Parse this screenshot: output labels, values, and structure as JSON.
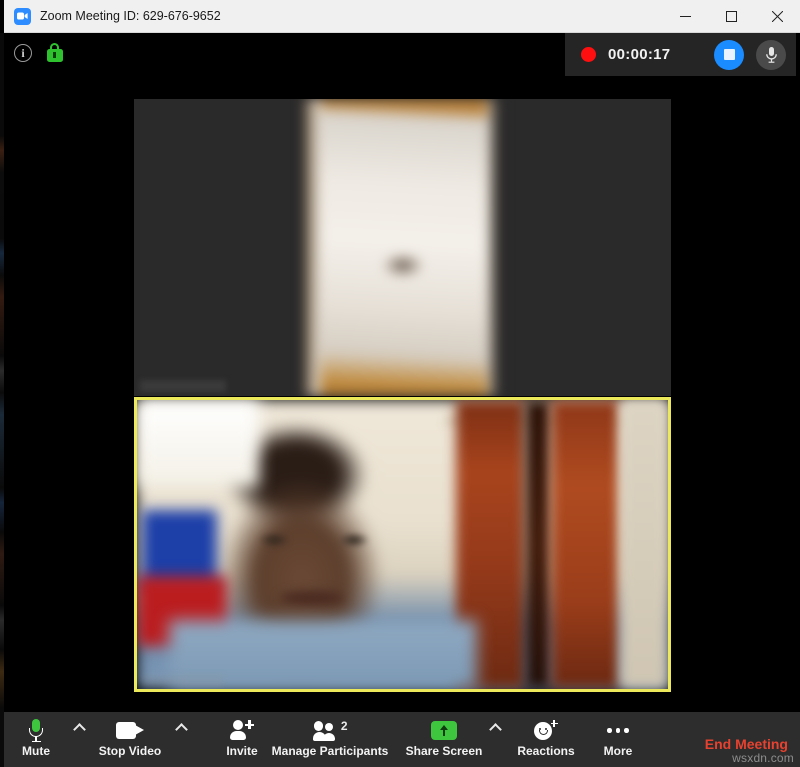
{
  "window": {
    "title": "Zoom Meeting ID: 629-676-9652",
    "app_icon": "zoom-camera-icon",
    "controls": {
      "minimize": "minimize-icon",
      "maximize": "maximize-icon",
      "close": "close-icon"
    }
  },
  "topbar": {
    "info_icon": "info-icon",
    "info_glyph": "i",
    "encryption_icon": "green-lock-icon",
    "recording": {
      "indicator": "record-dot-icon",
      "elapsed": "00:00:17",
      "stop_button": "stop-recording-icon",
      "mic_button": "microphone-icon",
      "accent_color": "#1a8cff",
      "record_color": "#ff0f0f"
    }
  },
  "stage": {
    "tiles": [
      {
        "id": "participant-video-1",
        "name_label": "",
        "active_speaker": false,
        "description": "blurred portrait video of a white door and wall"
      },
      {
        "id": "participant-video-2",
        "name_label": "",
        "active_speaker": true,
        "border_color": "#ece95a",
        "description": "blurred webcam of a person wearing glasses, orange curtains behind"
      }
    ]
  },
  "toolbar": {
    "items": [
      {
        "label": "Mute",
        "icon": "microphone-icon",
        "caret": true,
        "accent": "#3ec73e"
      },
      {
        "label": "Stop Video",
        "icon": "video-camera-icon",
        "caret": true,
        "accent": "#ffffff"
      },
      {
        "label": "Invite",
        "icon": "add-person-icon",
        "caret": false,
        "accent": "#ffffff"
      },
      {
        "label": "Manage Participants",
        "icon": "participants-icon",
        "caret": false,
        "badge": "2"
      },
      {
        "label": "Share Screen",
        "icon": "share-screen-icon",
        "caret": true,
        "accent": "#3ec73e"
      },
      {
        "label": "Reactions",
        "icon": "smiley-plus-icon",
        "caret": false,
        "accent": "#ffffff"
      },
      {
        "label": "More",
        "icon": "ellipsis-icon",
        "caret": false,
        "accent": "#ffffff"
      }
    ],
    "end_meeting": "End Meeting",
    "end_meeting_color": "#e8412f"
  },
  "watermark": "wsxdn.com"
}
